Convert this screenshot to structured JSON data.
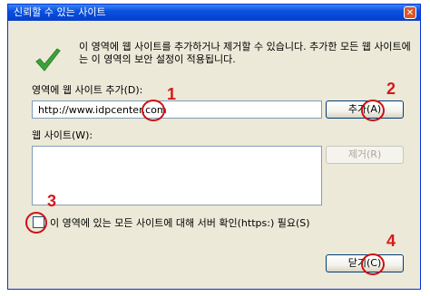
{
  "window": {
    "title": "신뢰할 수 있는 사이트",
    "close_glyph": "✕"
  },
  "info_text": "이 영역에 웹 사이트를 추가하거나 제거할 수 있습니다. 추가한 모든 웹 사이트에는 이 영역의 보안 설정이 적용됩니다.",
  "add_site": {
    "label": "영역에 웹 사이트 추가(D):",
    "value": "http://www.idpcenter.com"
  },
  "add_button": {
    "label": "추가(A)"
  },
  "sites": {
    "label": "웹 사이트(W):",
    "items": []
  },
  "remove_button": {
    "label": "제거(R)"
  },
  "https_check": {
    "label": "이 영역에 있는 모든 사이트에 대해 서버 확인(https:) 필요(S)",
    "checked": false
  },
  "close_button": {
    "label": "닫기(C)"
  },
  "annotations": [
    "1",
    "2",
    "3",
    "4"
  ],
  "colors": {
    "annotation": "#d41a1a",
    "titlebar": "#0a51df",
    "dialog_bg": "#ece9d8"
  }
}
